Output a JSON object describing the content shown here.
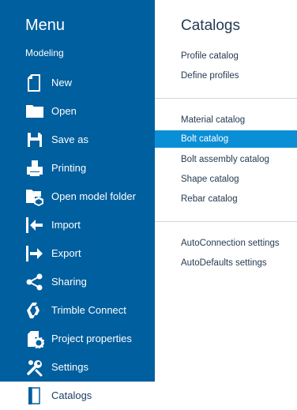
{
  "colors": {
    "menu_bg": "#005f9e",
    "selected_bg": "#0a8fd6",
    "text_dark": "#253b52"
  },
  "menu": {
    "title": "Menu",
    "subtitle": "Modeling",
    "items": [
      {
        "label": "New",
        "icon": "new-file-icon"
      },
      {
        "label": "Open",
        "icon": "folder-icon"
      },
      {
        "label": "Save as",
        "icon": "save-icon"
      },
      {
        "label": "Printing",
        "icon": "printer-icon"
      },
      {
        "label": "Open model folder",
        "icon": "model-folder-icon"
      },
      {
        "label": "Import",
        "icon": "import-icon"
      },
      {
        "label": "Export",
        "icon": "export-icon"
      },
      {
        "label": "Sharing",
        "icon": "share-icon"
      },
      {
        "label": "Trimble Connect",
        "icon": "trimble-connect-icon"
      },
      {
        "label": "Project properties",
        "icon": "project-properties-icon"
      },
      {
        "label": "Settings",
        "icon": "settings-icon"
      },
      {
        "label": "Catalogs",
        "icon": "catalogs-icon",
        "active": true
      }
    ]
  },
  "catalogs": {
    "title": "Catalogs",
    "group1": [
      "Profile catalog",
      "Define profiles"
    ],
    "group2": [
      "Material catalog",
      "Bolt catalog",
      "Bolt assembly catalog",
      "Shape catalog",
      "Rebar catalog"
    ],
    "group3": [
      "AutoConnection settings",
      "AutoDefaults settings"
    ],
    "selected": "Bolt catalog"
  }
}
